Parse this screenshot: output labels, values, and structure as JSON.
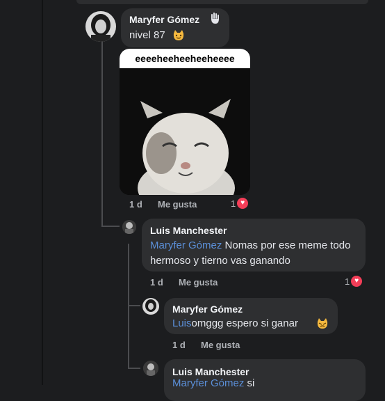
{
  "comments": [
    {
      "name": "Maryfer Gómez",
      "badge": "nivel 87",
      "meme_caption": "eeeeheeheeheeheeee",
      "time": "1 d",
      "like_label": "Me gusta",
      "reaction_count": "1"
    },
    {
      "name": "Luis Manchester",
      "mention": "Maryfer Gómez",
      "text": "Nomas por ese meme todo hermoso y tierno vas ganando",
      "time": "1 d",
      "like_label": "Me gusta",
      "reaction_count": "1"
    },
    {
      "name": "Maryfer Gómez",
      "mention": "Luis",
      "text": "omggg espero si ganar",
      "time": "1 d",
      "like_label": "Me gusta"
    },
    {
      "name": "Luis Manchester",
      "mention": "Maryfer Gómez",
      "text": "si"
    }
  ]
}
